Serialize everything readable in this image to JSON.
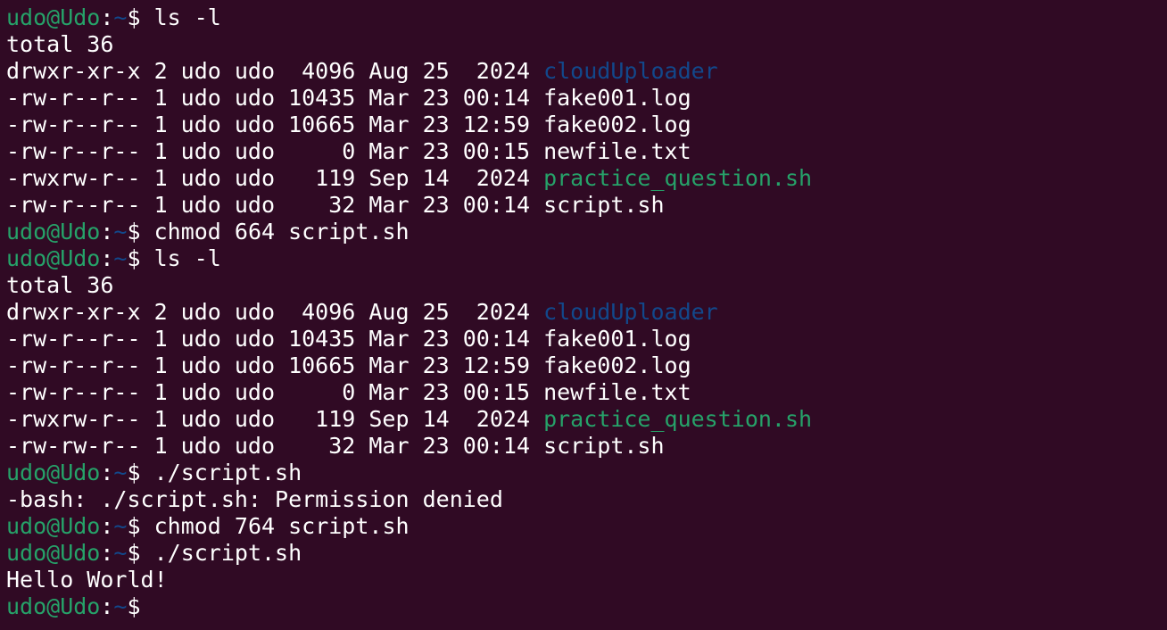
{
  "terminal": {
    "colors": {
      "background": "#300a24",
      "default": "#ffffff",
      "user_host": "#26a269",
      "path": "#12488b",
      "directory": "#12488b",
      "executable": "#26a269"
    },
    "lines": [
      {
        "type": "prompt",
        "segments": [
          {
            "text": "udo@Udo",
            "role": "user_host"
          },
          {
            "text": ":",
            "role": "default"
          },
          {
            "text": "~",
            "role": "path"
          },
          {
            "text": "$ ls -l",
            "role": "default"
          }
        ]
      },
      {
        "type": "output",
        "segments": [
          {
            "text": "total 36",
            "role": "default"
          }
        ]
      },
      {
        "type": "listing-row",
        "segments": [
          {
            "text": "drwxr-xr-x 2 udo udo  4096 Aug 25  2024 ",
            "role": "default"
          },
          {
            "text": "cloudUploader",
            "role": "directory"
          }
        ]
      },
      {
        "type": "listing-row",
        "segments": [
          {
            "text": "-rw-r--r-- 1 udo udo 10435 Mar 23 00:14 ",
            "role": "default"
          },
          {
            "text": "fake001.log",
            "role": "default"
          }
        ]
      },
      {
        "type": "listing-row",
        "segments": [
          {
            "text": "-rw-r--r-- 1 udo udo 10665 Mar 23 12:59 ",
            "role": "default"
          },
          {
            "text": "fake002.log",
            "role": "default"
          }
        ]
      },
      {
        "type": "listing-row",
        "segments": [
          {
            "text": "-rw-r--r-- 1 udo udo     0 Mar 23 00:15 ",
            "role": "default"
          },
          {
            "text": "newfile.txt",
            "role": "default"
          }
        ]
      },
      {
        "type": "listing-row",
        "segments": [
          {
            "text": "-rwxrw-r-- 1 udo udo   119 Sep 14  2024 ",
            "role": "default"
          },
          {
            "text": "practice_question.sh",
            "role": "executable"
          }
        ]
      },
      {
        "type": "listing-row",
        "segments": [
          {
            "text": "-rw-r--r-- 1 udo udo    32 Mar 23 00:14 ",
            "role": "default"
          },
          {
            "text": "script.sh",
            "role": "default"
          }
        ]
      },
      {
        "type": "prompt",
        "segments": [
          {
            "text": "udo@Udo",
            "role": "user_host"
          },
          {
            "text": ":",
            "role": "default"
          },
          {
            "text": "~",
            "role": "path"
          },
          {
            "text": "$ chmod 664 script.sh",
            "role": "default"
          }
        ]
      },
      {
        "type": "prompt",
        "segments": [
          {
            "text": "udo@Udo",
            "role": "user_host"
          },
          {
            "text": ":",
            "role": "default"
          },
          {
            "text": "~",
            "role": "path"
          },
          {
            "text": "$ ls -l",
            "role": "default"
          }
        ]
      },
      {
        "type": "output",
        "segments": [
          {
            "text": "total 36",
            "role": "default"
          }
        ]
      },
      {
        "type": "listing-row",
        "segments": [
          {
            "text": "drwxr-xr-x 2 udo udo  4096 Aug 25  2024 ",
            "role": "default"
          },
          {
            "text": "cloudUploader",
            "role": "directory"
          }
        ]
      },
      {
        "type": "listing-row",
        "segments": [
          {
            "text": "-rw-r--r-- 1 udo udo 10435 Mar 23 00:14 ",
            "role": "default"
          },
          {
            "text": "fake001.log",
            "role": "default"
          }
        ]
      },
      {
        "type": "listing-row",
        "segments": [
          {
            "text": "-rw-r--r-- 1 udo udo 10665 Mar 23 12:59 ",
            "role": "default"
          },
          {
            "text": "fake002.log",
            "role": "default"
          }
        ]
      },
      {
        "type": "listing-row",
        "segments": [
          {
            "text": "-rw-r--r-- 1 udo udo     0 Mar 23 00:15 ",
            "role": "default"
          },
          {
            "text": "newfile.txt",
            "role": "default"
          }
        ]
      },
      {
        "type": "listing-row",
        "segments": [
          {
            "text": "-rwxrw-r-- 1 udo udo   119 Sep 14  2024 ",
            "role": "default"
          },
          {
            "text": "practice_question.sh",
            "role": "executable"
          }
        ]
      },
      {
        "type": "listing-row",
        "segments": [
          {
            "text": "-rw-rw-r-- 1 udo udo    32 Mar 23 00:14 ",
            "role": "default"
          },
          {
            "text": "script.sh",
            "role": "default"
          }
        ]
      },
      {
        "type": "prompt",
        "segments": [
          {
            "text": "udo@Udo",
            "role": "user_host"
          },
          {
            "text": ":",
            "role": "default"
          },
          {
            "text": "~",
            "role": "path"
          },
          {
            "text": "$ ./script.sh",
            "role": "default"
          }
        ]
      },
      {
        "type": "output",
        "segments": [
          {
            "text": "-bash: ./script.sh: Permission denied",
            "role": "default"
          }
        ]
      },
      {
        "type": "prompt",
        "segments": [
          {
            "text": "udo@Udo",
            "role": "user_host"
          },
          {
            "text": ":",
            "role": "default"
          },
          {
            "text": "~",
            "role": "path"
          },
          {
            "text": "$ chmod 764 script.sh",
            "role": "default"
          }
        ]
      },
      {
        "type": "prompt",
        "segments": [
          {
            "text": "udo@Udo",
            "role": "user_host"
          },
          {
            "text": ":",
            "role": "default"
          },
          {
            "text": "~",
            "role": "path"
          },
          {
            "text": "$ ./script.sh",
            "role": "default"
          }
        ]
      },
      {
        "type": "output",
        "segments": [
          {
            "text": "Hello World!",
            "role": "default"
          }
        ]
      },
      {
        "type": "prompt",
        "segments": [
          {
            "text": "udo@Udo",
            "role": "user_host"
          },
          {
            "text": ":",
            "role": "default"
          },
          {
            "text": "~",
            "role": "path"
          },
          {
            "text": "$",
            "role": "default"
          }
        ]
      }
    ]
  }
}
